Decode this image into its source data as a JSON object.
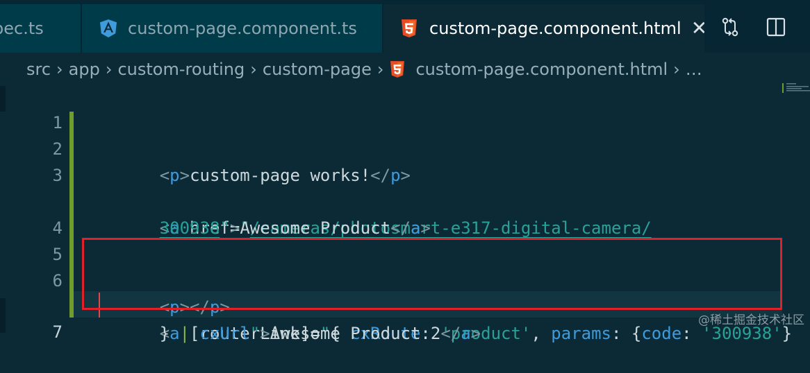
{
  "tabs": [
    {
      "label": "pec.ts",
      "icon": "typescript-spec-icon"
    },
    {
      "label": "custom-page.component.ts",
      "icon": "angular-icon"
    },
    {
      "label": "custom-page.component.html",
      "icon": "html5-icon",
      "close": "✕"
    }
  ],
  "toolbar": {
    "compare_icon": "git-compare-icon",
    "split_icon": "split-editor-icon"
  },
  "breadcrumb": {
    "items": [
      "src",
      "app",
      "custom-routing",
      "custom-page",
      "custom-page.component.html",
      "…"
    ],
    "separator": "›"
  },
  "editor": {
    "line_numbers": [
      "1",
      "2",
      "3",
      "",
      "4",
      "5",
      "6",
      "",
      "7"
    ],
    "line1": {
      "open": "<",
      "tag": "p",
      "close": ">",
      "text": "custom-page works!",
      "end_open": "</",
      "end_tag": "p",
      "end_close": ">"
    },
    "line3a": {
      "open": "<",
      "tag": "a",
      "attr": " href=",
      "q": "\"",
      "url": "/cameras/photosmart-e317-digital-camera/"
    },
    "line3b": {
      "url": "300938",
      "q": "\"",
      "close": ">",
      "text": "Awesome Product",
      "end_open": "</",
      "end_tag": "a",
      "end_close": ">"
    },
    "line5": {
      "open": "<",
      "tag": "p",
      "close": "></",
      "end_tag": "p",
      "end_close": ">"
    },
    "line6a": {
      "open": "<",
      "tag": "a",
      "attr": " [routerLink]=",
      "q": "\"",
      "brace": "{ ",
      "k1": "cxRoute",
      "colon1": ": ",
      "v1": "'product'",
      "comma": ", ",
      "k2": "params",
      "colon2": ": {",
      "k3": "code",
      "colon3": ": ",
      "v3": "'300938'",
      "brace2": "}"
    },
    "line6b": {
      "brace": "} ",
      "pipe": "|",
      "sp": " ",
      "pipe_name": "cxUrl",
      "q": "\"",
      "close": ">",
      "text": "Awesome Product 2",
      "end_open": "</",
      "end_tag": "a",
      "end_close": ">"
    }
  },
  "watermark": "@稀土掘金技术社区",
  "colors": {
    "tag": "#3e9bdc",
    "string": "#2aa198",
    "highlight_border": "#e0212a",
    "modified_gutter": "#6f9c2c"
  }
}
